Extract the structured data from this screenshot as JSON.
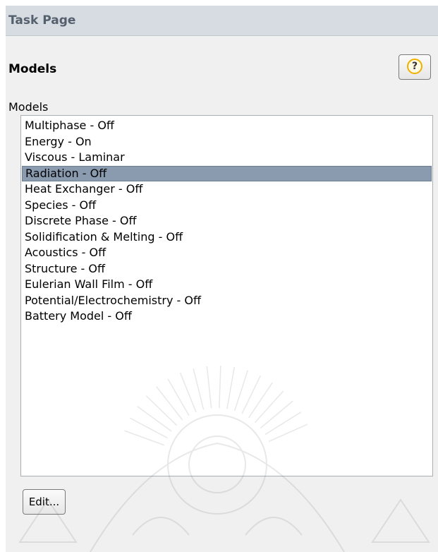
{
  "header": {
    "title": "Task Page"
  },
  "section": {
    "title": "Models"
  },
  "help": {
    "glyph": "?"
  },
  "models_group": {
    "label": "Models",
    "selected_index": 3,
    "items": [
      "Multiphase - Off",
      "Energy - On",
      "Viscous - Laminar",
      "Radiation - Off",
      "Heat Exchanger - Off",
      "Species - Off",
      "Discrete Phase - Off",
      "Solidification & Melting - Off",
      "Acoustics - Off",
      "Structure - Off",
      "Eulerian Wall Film - Off",
      "Potential/Electrochemistry - Off",
      "Battery Model - Off"
    ]
  },
  "actions": {
    "edit_label": "Edit..."
  },
  "colors": {
    "header_bg": "#d7dbe2",
    "selection": "#8a9bb0",
    "help_ring": "#f0b000"
  }
}
